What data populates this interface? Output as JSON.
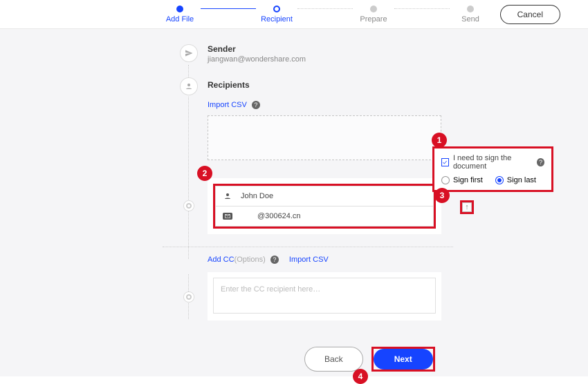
{
  "header": {
    "steps": [
      {
        "label": "Add File",
        "state": "active"
      },
      {
        "label": "Recipient",
        "state": "active"
      },
      {
        "label": "Prepare",
        "state": "pending"
      },
      {
        "label": "Send",
        "state": "pending"
      }
    ],
    "cancel_label": "Cancel"
  },
  "sender": {
    "title": "Sender",
    "email": "jiangwan@wondershare.com"
  },
  "recipients": {
    "title": "Recipients",
    "import_csv_label": "Import CSV"
  },
  "sign_options": {
    "need_sign_label": "I need to sign the document",
    "need_sign_checked": true,
    "sign_first_label": "Sign first",
    "sign_last_label": "Sign last",
    "selected": "last"
  },
  "recipient_entry": {
    "name": "John Doe",
    "email": "@300624.cn"
  },
  "cc": {
    "add_cc_label": "Add CC",
    "options_label": "(Options)",
    "import_csv_label": "Import CSV",
    "placeholder": "Enter the CC recipient here…"
  },
  "buttons": {
    "back_label": "Back",
    "next_label": "Next"
  },
  "annotations": {
    "a1": "1",
    "a2": "2",
    "a3": "3",
    "a4": "4"
  }
}
